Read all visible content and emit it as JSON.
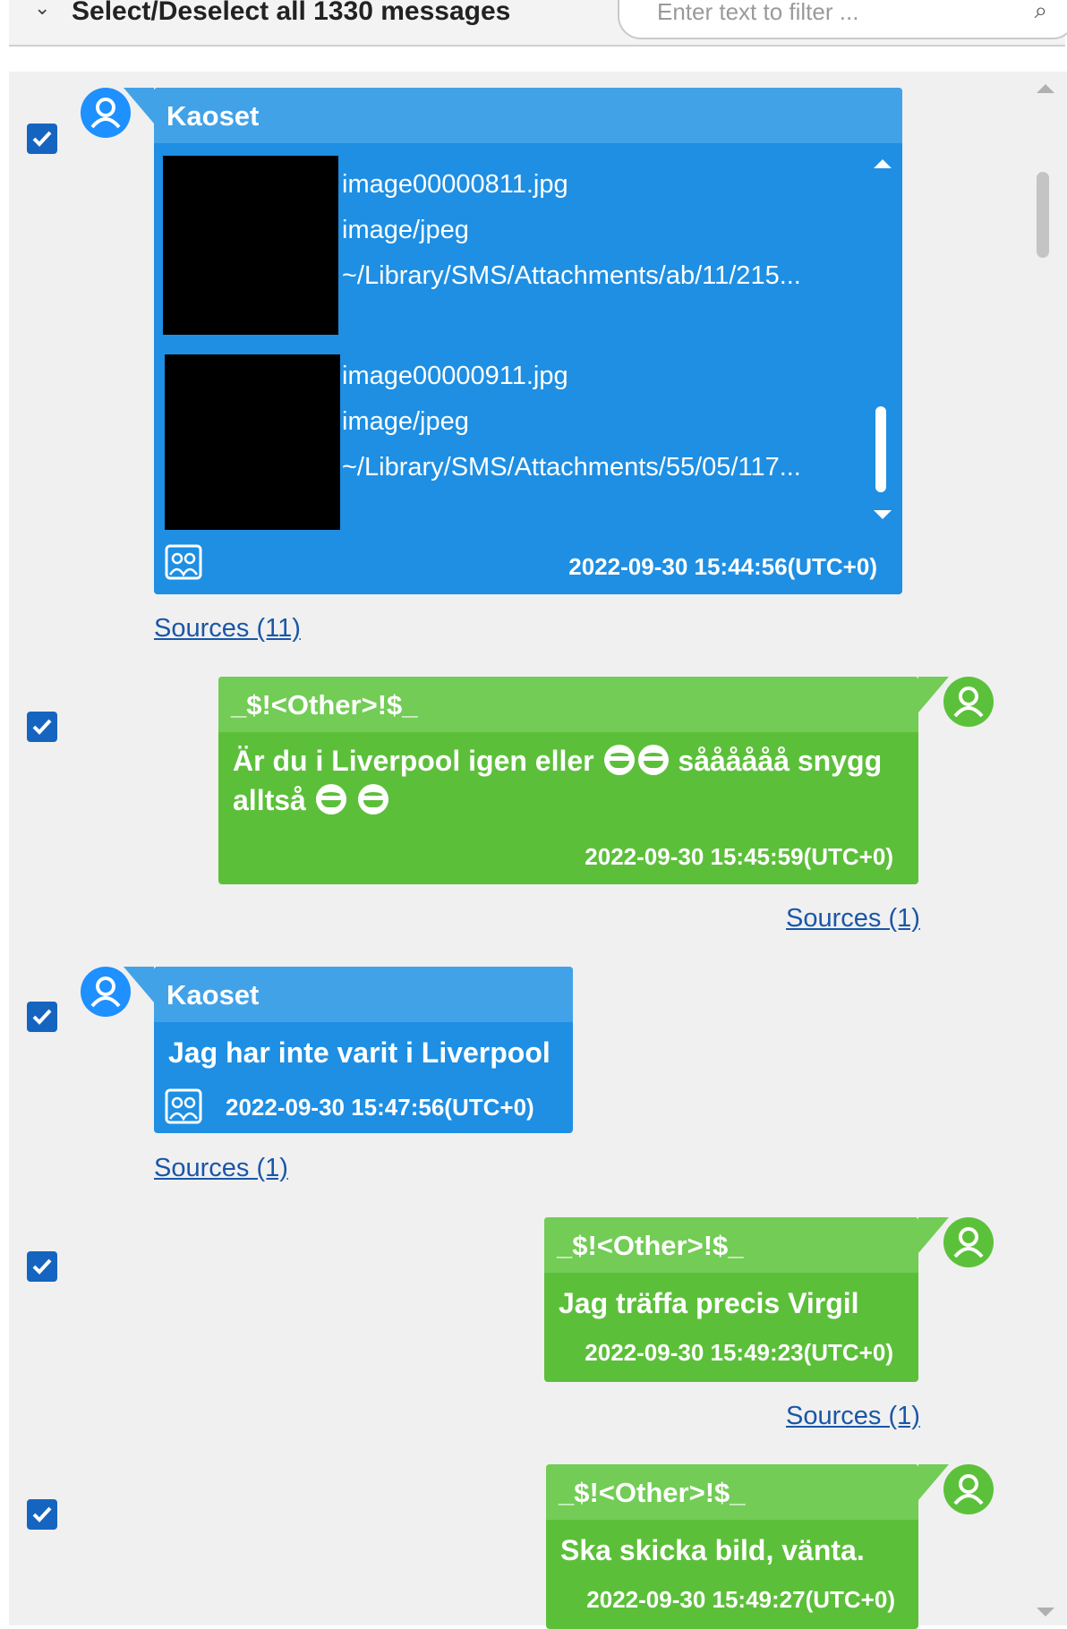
{
  "toolbar": {
    "select_all_label": "Select/Deselect all 1330 messages",
    "filter_placeholder": "Enter text to filter ..."
  },
  "messages": [
    {
      "sender": "Kaoset",
      "direction": "incoming",
      "attachments": [
        {
          "name": "image00000811.jpg",
          "mime": "image/jpeg",
          "path": "~/Library/SMS/Attachments/ab/11/215..."
        },
        {
          "name": "image00000911.jpg",
          "mime": "image/jpeg",
          "path": "~/Library/SMS/Attachments/55/05/117..."
        }
      ],
      "timestamp": "2022-09-30 15:44:56(UTC+0)",
      "sources": "Sources (11)",
      "checked": true
    },
    {
      "sender": "_$!<Other>!$_",
      "direction": "outgoing",
      "text_line1": "Är du i Liverpool igen eller",
      "text_line1_end": "såååååå snygg",
      "text_line2": "alltså",
      "timestamp": "2022-09-30 15:45:59(UTC+0)",
      "sources": "Sources (1)",
      "checked": true
    },
    {
      "sender": "Kaoset",
      "direction": "incoming",
      "text": "Jag har inte varit i Liverpool",
      "timestamp": "2022-09-30 15:47:56(UTC+0)",
      "sources": "Sources (1)",
      "checked": true
    },
    {
      "sender": "_$!<Other>!$_",
      "direction": "outgoing",
      "text": "Jag träffa precis Virgil",
      "timestamp": "2022-09-30 15:49:23(UTC+0)",
      "sources": "Sources (1)",
      "checked": true
    },
    {
      "sender": "_$!<Other>!$_",
      "direction": "outgoing",
      "text": "Ska skicka bild, vänta.",
      "timestamp": "2022-09-30 15:49:27(UTC+0)",
      "checked": true
    }
  ],
  "colors": {
    "incoming_bubble": "#1e8fe3",
    "outgoing_bubble": "#5cbf3a",
    "checkbox": "#1565c0",
    "link": "#1a56a8"
  }
}
